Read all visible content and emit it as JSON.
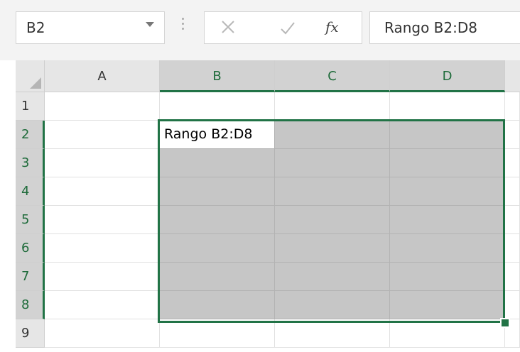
{
  "name_box": {
    "value": "B2"
  },
  "formula_bar": {
    "insert_function_label": "fx",
    "content": "Rango B2:D8"
  },
  "columns": [
    "A",
    "B",
    "C",
    "D"
  ],
  "rows": [
    "1",
    "2",
    "3",
    "4",
    "5",
    "6",
    "7",
    "8",
    "9"
  ],
  "selection": {
    "range": "B2:D8"
  },
  "cells": {
    "B2": "Rango B2:D8"
  },
  "colors": {
    "accent": "#217346",
    "selected_fill": "#c6c6c6"
  },
  "icons": [
    "dropdown-arrow-icon",
    "more-options-icon",
    "cancel-icon",
    "enter-icon",
    "insert-function-icon",
    "select-all-icon"
  ]
}
